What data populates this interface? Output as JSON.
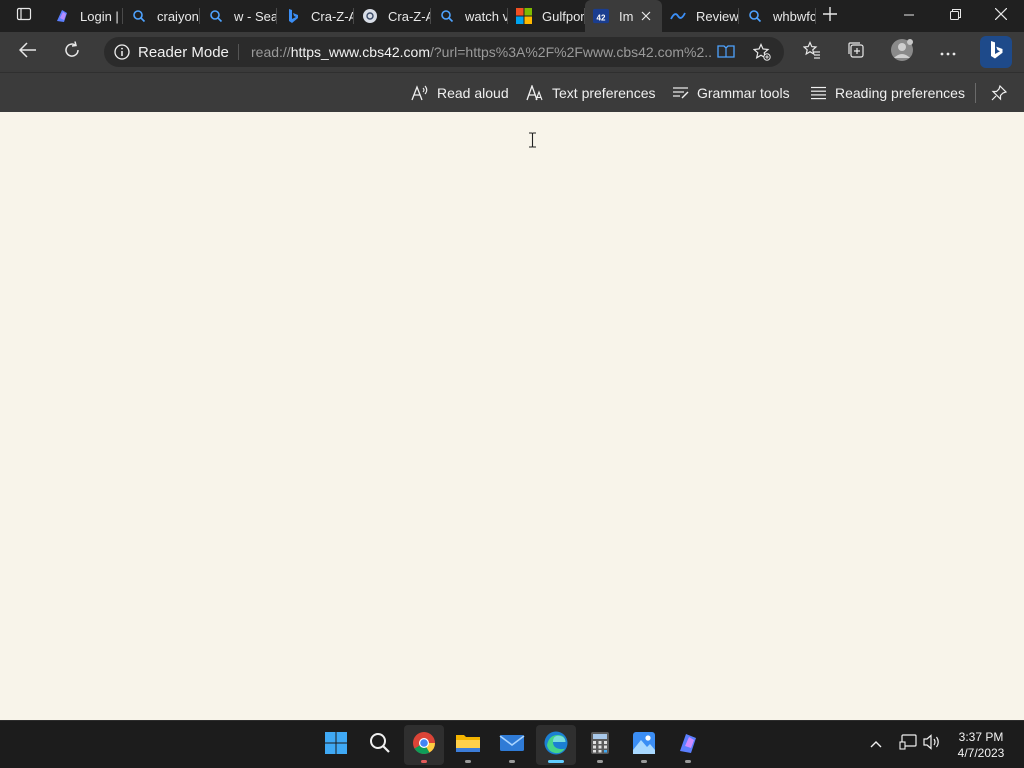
{
  "tabs": [
    {
      "label": "Login |",
      "icon": "copilot-icon"
    },
    {
      "label": "craiyon",
      "icon": "search-icon"
    },
    {
      "label": "w - Sea",
      "icon": "search-icon"
    },
    {
      "label": "Cra-Z-A",
      "icon": "bing-icon"
    },
    {
      "label": "Cra-Z-A",
      "icon": "site-icon"
    },
    {
      "label": "watch v",
      "icon": "search-icon"
    },
    {
      "label": "Gulfpor",
      "icon": "microsoft-icon"
    },
    {
      "label": "Im",
      "icon": "cbs42-icon",
      "active": true
    },
    {
      "label": "Review",
      "icon": "site-icon"
    },
    {
      "label": "whbwfc",
      "icon": "search-icon"
    }
  ],
  "address": {
    "reader_mode_label": "Reader Mode",
    "url_prefix": "read://",
    "url_host": "https_www.cbs42.com",
    "url_rest": "/?url=https%3A%2F%2Fwww.cbs42.com%2..."
  },
  "reader_toolbar": {
    "read_aloud": "Read aloud",
    "text_preferences": "Text preferences",
    "grammar_tools": "Grammar tools",
    "reading_preferences": "Reading preferences"
  },
  "taskbar": {
    "apps": [
      "start-icon",
      "search-icon",
      "chrome-icon",
      "file-explorer-icon",
      "mail-icon",
      "edge-icon",
      "calculator-icon",
      "photos-icon",
      "copilot-icon"
    ],
    "time": "3:37 PM",
    "date": "4/7/2023"
  },
  "colors": {
    "reader_background": "#f8f4ea",
    "chrome_dark": "#202020",
    "toolbar": "#3b3b3b",
    "accent": "#60cdff"
  }
}
